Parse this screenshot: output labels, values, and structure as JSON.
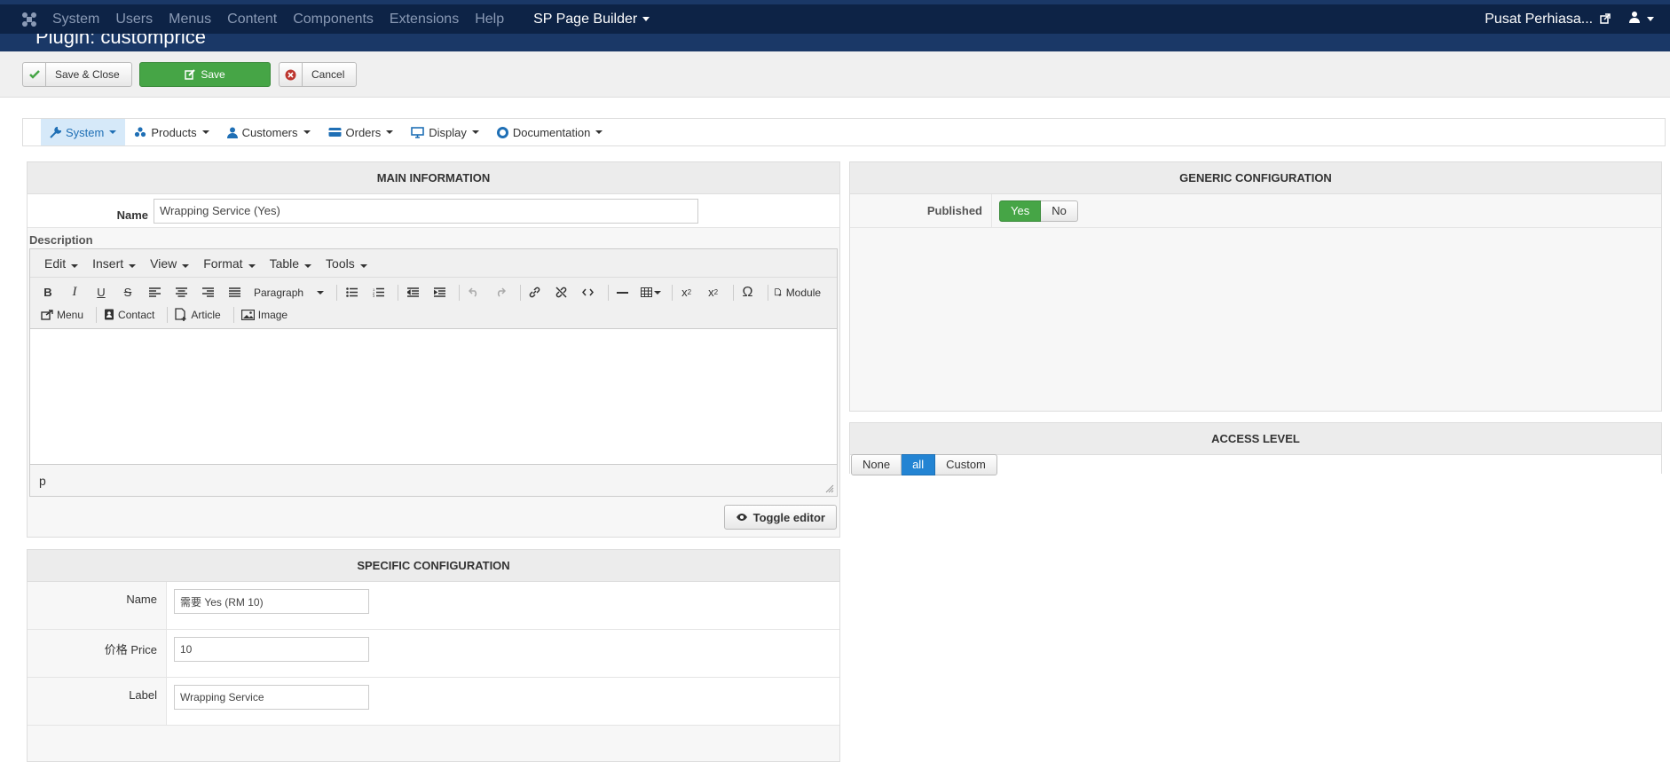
{
  "nav": {
    "items": [
      "System",
      "Users",
      "Menus",
      "Content",
      "Components",
      "Extensions",
      "Help"
    ],
    "sp_page_builder": "SP Page Builder",
    "site_name": "Pusat Perhiasa..."
  },
  "page_title": "Plugin: customprice",
  "toolbar": {
    "save_close": "Save & Close",
    "save": "Save",
    "cancel": "Cancel"
  },
  "submenu": {
    "items": [
      "System",
      "Products",
      "Customers",
      "Orders",
      "Display",
      "Documentation"
    ],
    "active": "System"
  },
  "main_info": {
    "heading": "MAIN INFORMATION",
    "name_label": "Name",
    "name_value": "Wrapping Service (Yes)",
    "description_label": "Description",
    "editor": {
      "menus": [
        "Edit",
        "Insert",
        "View",
        "Format",
        "Table",
        "Tools"
      ],
      "format_select": "Paragraph",
      "module_btn": "Module",
      "menu_btn": "Menu",
      "contact_btn": "Contact",
      "article_btn": "Article",
      "image_btn": "Image",
      "status_path": "p"
    },
    "toggle_editor": "Toggle editor"
  },
  "specific": {
    "heading": "SPECIFIC CONFIGURATION",
    "rows": [
      {
        "label": "Name",
        "value": "需要 Yes (RM 10)"
      },
      {
        "label": "价格 Price",
        "value": "10"
      },
      {
        "label": "Label",
        "value": "Wrapping Service"
      }
    ]
  },
  "generic": {
    "heading": "GENERIC CONFIGURATION",
    "published_label": "Published",
    "yes": "Yes",
    "no": "No"
  },
  "access": {
    "heading": "ACCESS LEVEL",
    "none": "None",
    "all": "all",
    "custom": "Custom"
  },
  "colors": {
    "navbar": "#0d2346",
    "header": "#1a3867",
    "green": "#46a546",
    "blue": "#2384d3"
  }
}
